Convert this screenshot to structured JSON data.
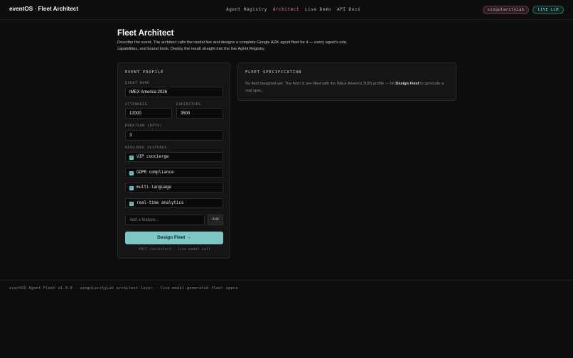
{
  "brand": {
    "name": "eventOS",
    "separator": "·",
    "product": "Fleet Architect"
  },
  "nav": [
    {
      "label": "Agent Registry",
      "active": false
    },
    {
      "label": "Architect",
      "active": true
    },
    {
      "label": "Live Demo",
      "active": false
    },
    {
      "label": "API Docs",
      "active": false
    }
  ],
  "header_pills": {
    "user": "singularityLab",
    "live": "LIVE LLM"
  },
  "page": {
    "title": "Fleet Architect",
    "description": "Describe the event. The architect calls the model live and designs a complete Google ADK agent fleet for it — every agent's role, capabilities, and bound tools. Deploy the result straight into the live Agent Registry."
  },
  "profile": {
    "heading": "EVENT PROFILE",
    "event_name_label": "EVENT NAME",
    "event_name": "IMEX America 2026",
    "attendees_label": "ATTENDEES",
    "attendees": "12000",
    "exhibitors_label": "EXHIBITORS",
    "exhibitors": "3500",
    "duration_label": "DURATION (DAYS)",
    "duration": "3",
    "features_label": "REQUIRED FEATURES",
    "features": [
      {
        "label": "VIP concierge",
        "checked": true
      },
      {
        "label": "GDPR compliance",
        "checked": true
      },
      {
        "label": "multi-language",
        "checked": true
      },
      {
        "label": "real-time analytics",
        "checked": true
      }
    ],
    "add_placeholder": "Add a feature...",
    "add_button": "Add",
    "design_button": "Design Fleet →",
    "endpoint_note": "POST /architect · live model call"
  },
  "spec": {
    "heading": "FLEET SPECIFICATION",
    "text_before": "No fleet designed yet. The form is pre-filled with the IMEX America 2026 profile — hit ",
    "text_bold": "Design Fleet",
    "text_after": " to generate a real spec."
  },
  "footer": "eventOS Agent Fleet v1.0.0 · singularityLab architect layer · live model-generated fleet specs"
}
